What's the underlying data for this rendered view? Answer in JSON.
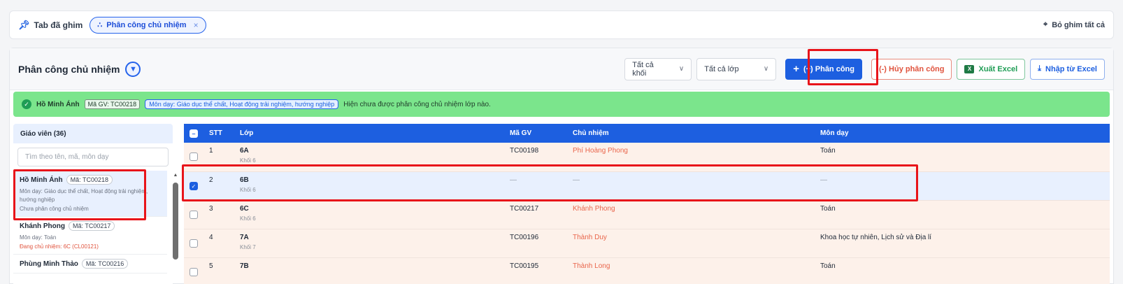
{
  "tabbar": {
    "pinned_label": "Tab đã ghim",
    "active_tab": "Phân công chủ nhiệm",
    "close_symbol": "×",
    "unpin_all": "Bỏ ghim tất cả"
  },
  "header": {
    "title": "Phân công chủ nhiệm",
    "grade_select": "Tất cả khối",
    "class_select": "Tất cả lớp",
    "assign_button": "(+) Phân công",
    "cancel_button": "(-) Hủy phân công",
    "export_button": "Xuất Excel",
    "import_button": "Nhập từ Excel"
  },
  "info": {
    "name": "Hồ Minh Ánh",
    "code": "Mã GV: TC00218",
    "subjects": "Môn dạy: Giáo dục thể chất, Hoạt động trải nghiệm, hướng nghiệp",
    "message": "Hiện chưa được phân công chủ nhiệm lớp nào."
  },
  "teachers": {
    "header": "Giáo viên (36)",
    "search_placeholder": "Tìm theo tên, mã, môn dạy",
    "items": [
      {
        "name": "Hồ Minh Ánh",
        "code": "Mã: TC00218",
        "subjects": "Môn dạy: Giáo dục thể chất, Hoạt động trải nghiệm, hướng nghiệp",
        "status": "Chưa phân công chủ nhiệm"
      },
      {
        "name": "Khánh Phong",
        "code": "Mã: TC00217",
        "subjects": "Môn dạy: Toán",
        "status": "Đang chủ nhiệm: 6C (CL00121)"
      },
      {
        "name": "Phùng Minh Thảo",
        "code": "Mã: TC00216",
        "subjects": "",
        "status": ""
      }
    ]
  },
  "table": {
    "columns": [
      "STT",
      "Lớp",
      "Mã GV",
      "Chủ nhiệm",
      "Môn dạy"
    ],
    "rows": [
      {
        "stt": "1",
        "class": "6A",
        "grade": "Khối 6",
        "code": "TC00198",
        "homeroom": "Phí Hoàng Phong",
        "subject": "Toán"
      },
      {
        "stt": "2",
        "class": "6B",
        "grade": "Khối 6",
        "code": "—",
        "homeroom": "—",
        "subject": "—"
      },
      {
        "stt": "3",
        "class": "6C",
        "grade": "Khối 6",
        "code": "TC00217",
        "homeroom": "Khánh Phong",
        "subject": "Toán"
      },
      {
        "stt": "4",
        "class": "7A",
        "grade": "Khối 7",
        "code": "TC00196",
        "homeroom": "Thành Duy",
        "subject": "Khoa học tự nhiên, Lịch sử và Địa lí"
      },
      {
        "stt": "5",
        "class": "7B",
        "grade": "",
        "code": "TC00195",
        "homeroom": "Thành Long",
        "subject": "Toán"
      }
    ]
  },
  "colors": {
    "primary": "#1d5fe0",
    "success_strip": "#7be58c",
    "danger": "#e0533d",
    "excel": "#1f9d55",
    "highlight": "#e8141a"
  }
}
